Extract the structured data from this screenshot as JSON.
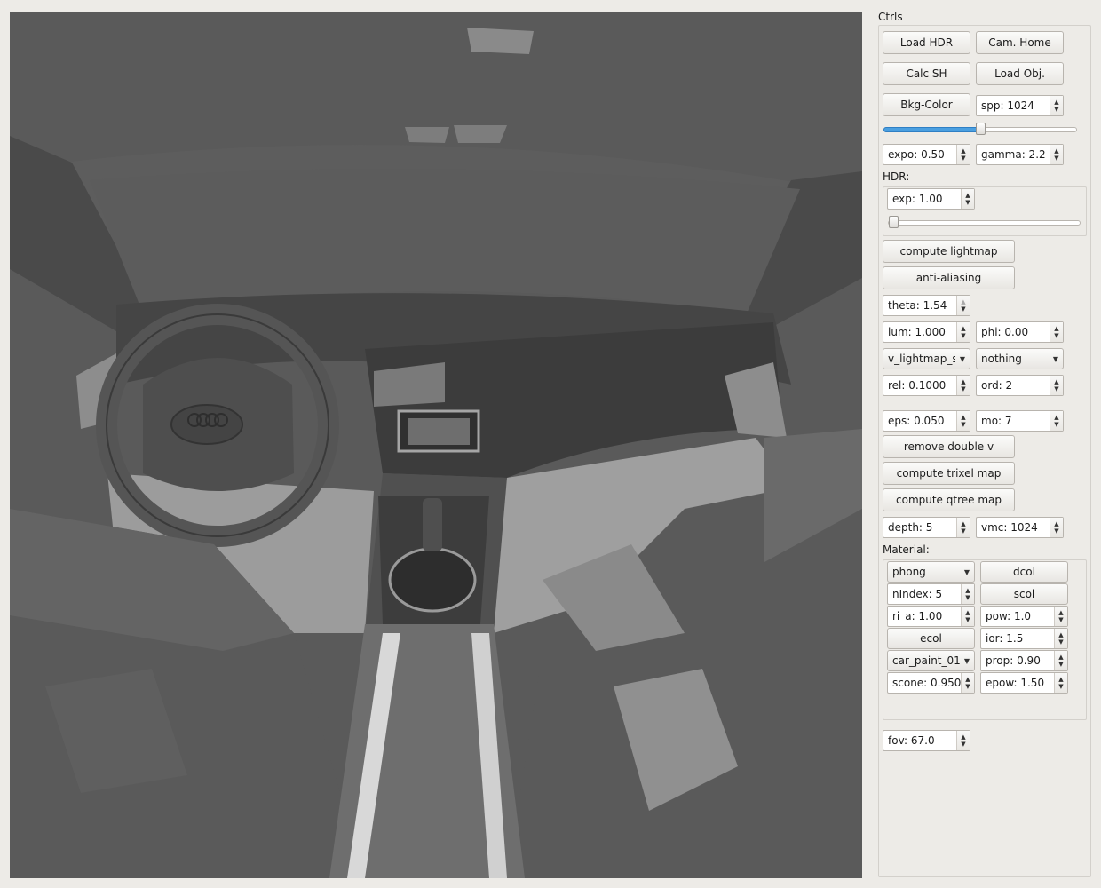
{
  "panel": {
    "title": "Ctrls",
    "load_hdr": "Load HDR",
    "cam_home": "Cam. Home",
    "calc_sh": "Calc SH",
    "load_obj": "Load Obj.",
    "bkg_color": "Bkg-Color",
    "spp": "spp: 1024",
    "spp_slider_level": 0.5,
    "expo": "expo: 0.50",
    "gamma": "gamma: 2.2",
    "hdr_label": "HDR:",
    "hdr_exp": "exp: 1.00",
    "hdr_slider_level": 0.0,
    "compute_lightmap": "compute lightmap",
    "anti_aliasing": "anti-aliasing",
    "theta": "theta: 1.54",
    "lum": "lum: 1.000",
    "phi": "phi: 0.00",
    "lightmap_select": "v_lightmap_s",
    "nothing_select": "nothing",
    "rel": "rel: 0.1000",
    "ord": "ord: 2",
    "eps": "eps: 0.050",
    "mo": "mo: 7",
    "remove_double": "remove double v",
    "compute_trixel": "compute trixel map",
    "compute_qtree": "compute qtree map",
    "depth": "depth: 5",
    "vmc": "vmc: 1024",
    "material_label": "Material:",
    "material": {
      "shader": "phong",
      "dcol": "dcol",
      "nindex": "nIndex: 5",
      "scol": "scol",
      "ri_a": "ri_a: 1.00",
      "pow": "pow: 1.0",
      "ecol": "ecol",
      "ior": "ior: 1.5",
      "material_select": "car_paint_01",
      "prop": "prop: 0.90",
      "scone": "scone: 0.950",
      "epow": "epow: 1.50"
    },
    "fov": "fov: 67.0"
  }
}
